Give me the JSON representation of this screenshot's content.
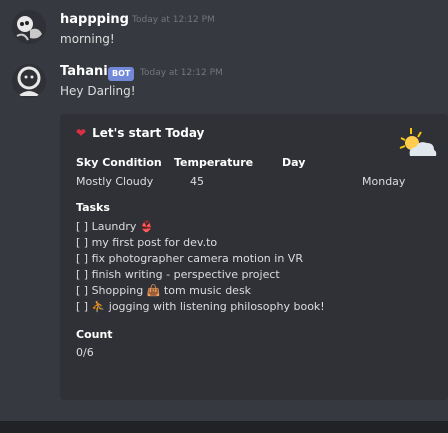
{
  "messages": [
    {
      "username": "happping",
      "timestamp": "Today at 12:12 PM",
      "text": "morning!"
    },
    {
      "username": "Tahani",
      "badge": "BOT",
      "timestamp": "Today at 12:12 PM",
      "text": "Hey Darling!"
    }
  ],
  "embed": {
    "title": "Let's start Today",
    "heart_icon": "red-heart",
    "thumbnail_icon": "sun-behind-cloud",
    "table": {
      "headers": [
        "Sky Condition",
        "Temperature",
        "Day"
      ],
      "values": [
        "Mostly Cloudy",
        "45",
        "Monday"
      ]
    },
    "tasks_label": "Tasks",
    "tasks": [
      "[ ] Laundry 👙",
      "[ ] my first post for dev.to",
      "[ ] fix photographer camera motion in VR",
      "[ ] finish writing - perspective project",
      "[ ] Shopping 👜 tom music desk",
      "[ ] ⛹ jogging with listening philosophy book!"
    ],
    "count_label": "Count",
    "count_value": "0/6"
  },
  "colors": {
    "background": "#36393f",
    "embed_bg": "#2f3136",
    "bot_badge": "#7289da",
    "timestamp": "#72767d",
    "heart": "#dd2e44"
  }
}
